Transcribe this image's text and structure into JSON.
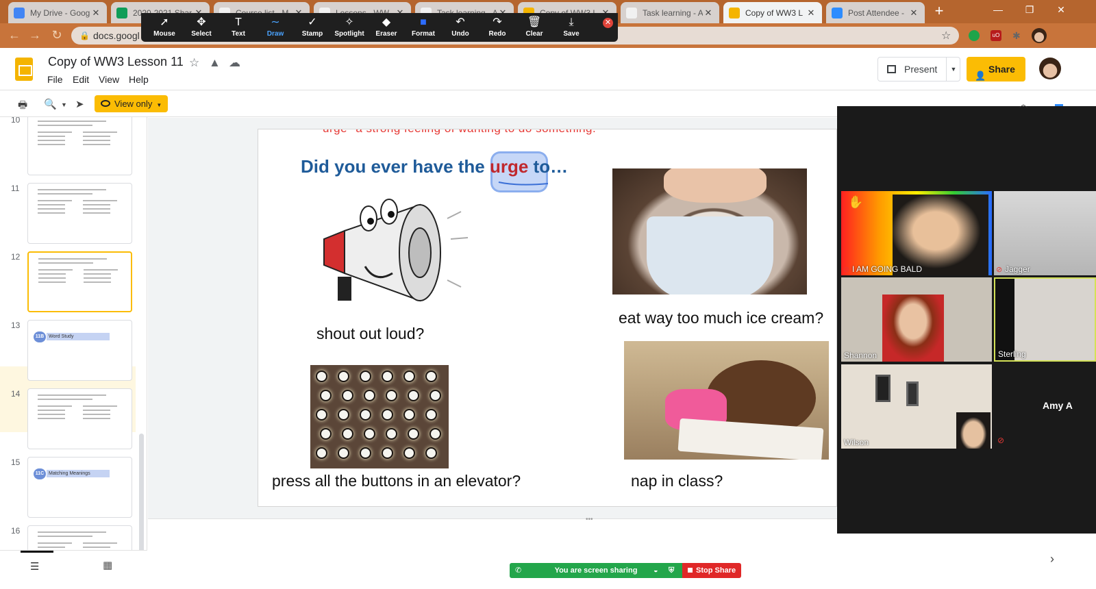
{
  "browser": {
    "tabs": [
      {
        "label": "My Drive - Goog",
        "color": "#4285f4",
        "active": false
      },
      {
        "label": "2020-2021 Shar",
        "color": "#0f9d58",
        "active": false
      },
      {
        "label": "Course list - M",
        "color": "#f1f1f1",
        "active": false
      },
      {
        "label": "Lessons - WW",
        "color": "#f1f1f1",
        "active": false
      },
      {
        "label": "Task learning - A",
        "color": "#f1f1f1",
        "active": false
      },
      {
        "label": "Copy of WW3 L",
        "color": "#f4b400",
        "active": false
      },
      {
        "label": "Task learning - A",
        "color": "#f1f1f1",
        "active": false
      },
      {
        "label": "Copy of WW3 L",
        "color": "#f4b400",
        "active": true
      },
      {
        "label": "Post Attendee -",
        "color": "#2d8cff",
        "active": false
      }
    ],
    "url": "docs.googl"
  },
  "annotation_toolbar": {
    "tools": [
      {
        "label": "Mouse",
        "icon": "arrow-pointer-icon",
        "glyph": "➚"
      },
      {
        "label": "Select",
        "icon": "move-icon",
        "glyph": "✥"
      },
      {
        "label": "Text",
        "icon": "text-icon",
        "glyph": "T"
      },
      {
        "label": "Draw",
        "icon": "draw-icon",
        "glyph": "∼",
        "active": true
      },
      {
        "label": "Stamp",
        "icon": "checkmark-icon",
        "glyph": "✓"
      },
      {
        "label": "Spotlight",
        "icon": "wand-icon",
        "glyph": "✧"
      },
      {
        "label": "Eraser",
        "icon": "eraser-icon",
        "glyph": "◆"
      },
      {
        "label": "Format",
        "icon": "format-square-icon",
        "glyph": "■"
      },
      {
        "label": "Undo",
        "icon": "undo-icon",
        "glyph": "↶"
      },
      {
        "label": "Redo",
        "icon": "redo-icon",
        "glyph": "↷"
      },
      {
        "label": "Clear",
        "icon": "trash-icon",
        "glyph": "🗑"
      },
      {
        "label": "Save",
        "icon": "download-icon",
        "glyph": "⤓"
      }
    ]
  },
  "app": {
    "title": "Copy of WW3 Lesson 11",
    "menus": [
      "File",
      "Edit",
      "View",
      "Help"
    ],
    "present_label": "Present",
    "share_label": "Share",
    "view_only_label": "View only"
  },
  "filmstrip": {
    "slides": [
      {
        "num": "10",
        "badge": "",
        "label": ""
      },
      {
        "num": "11",
        "badge": "",
        "label": ""
      },
      {
        "num": "12",
        "badge": "",
        "label": "",
        "selected": true
      },
      {
        "num": "13",
        "badge": "11B",
        "label": "Word Study"
      },
      {
        "num": "14",
        "badge": "",
        "label": ""
      },
      {
        "num": "15",
        "badge": "11C",
        "label": "Matching Meanings"
      },
      {
        "num": "16",
        "badge": "",
        "label": ""
      }
    ]
  },
  "slide": {
    "definition": "urge--a strong feeling of wanting to do something.",
    "question_before": "Did you ever have the ",
    "question_word": "urge",
    "question_after": " to…",
    "captions": {
      "shout": "shout out loud?",
      "icecream": "eat way too much ice cream?",
      "elevator": "press all the buttons in an elevator?",
      "nap": "nap in class?"
    }
  },
  "zoom": {
    "participants": [
      {
        "name": "I AM GOING BALD"
      },
      {
        "name": "Jagger"
      },
      {
        "name": "Shannon"
      },
      {
        "name": "Sterling"
      },
      {
        "name": "Wilson"
      },
      {
        "name": "Amy A"
      }
    ],
    "share_status": "You are screen sharing",
    "stop_share": "Stop Share"
  }
}
